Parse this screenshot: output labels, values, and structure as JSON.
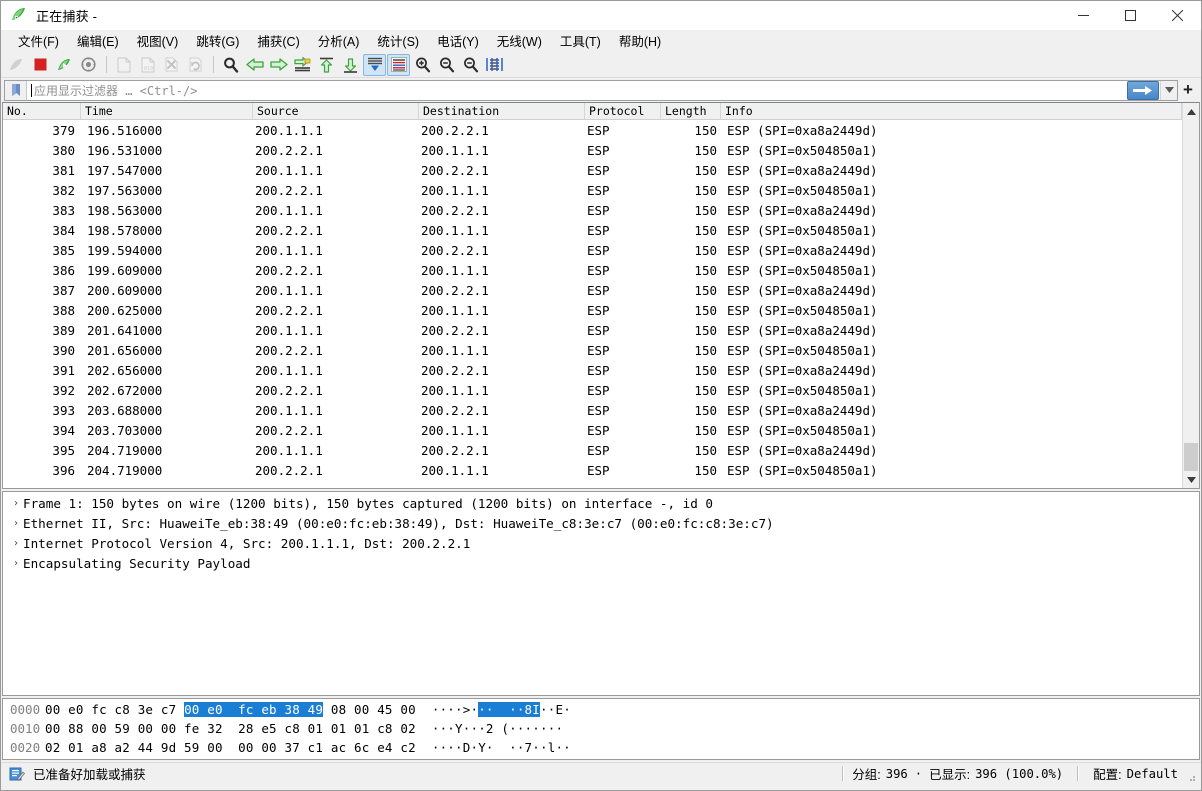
{
  "window": {
    "title": "正在捕获 -",
    "app_icon": "wireshark-shark-fin-icon",
    "minimize": "—",
    "maximize": "□",
    "close": "✕"
  },
  "menubar": [
    {
      "label": "文件(F)",
      "name": "menu-file"
    },
    {
      "label": "编辑(E)",
      "name": "menu-edit"
    },
    {
      "label": "视图(V)",
      "name": "menu-view"
    },
    {
      "label": "跳转(G)",
      "name": "menu-go"
    },
    {
      "label": "捕获(C)",
      "name": "menu-capture"
    },
    {
      "label": "分析(A)",
      "name": "menu-analyze"
    },
    {
      "label": "统计(S)",
      "name": "menu-statistics"
    },
    {
      "label": "电话(Y)",
      "name": "menu-telephony"
    },
    {
      "label": "无线(W)",
      "name": "menu-wireless"
    },
    {
      "label": "工具(T)",
      "name": "menu-tools"
    },
    {
      "label": "帮助(H)",
      "name": "menu-help"
    }
  ],
  "toolbar": {
    "items": [
      {
        "icon": "start-capture-icon",
        "state": "disabled"
      },
      {
        "icon": "stop-capture-icon",
        "state": "normal"
      },
      {
        "icon": "restart-capture-icon",
        "state": "normal"
      },
      {
        "icon": "capture-options-icon",
        "state": "normal"
      },
      {
        "icon": "separator",
        "state": "sep"
      },
      {
        "icon": "open-file-icon",
        "state": "disabled"
      },
      {
        "icon": "save-file-icon",
        "state": "disabled"
      },
      {
        "icon": "close-file-icon",
        "state": "disabled"
      },
      {
        "icon": "reload-file-icon",
        "state": "disabled"
      },
      {
        "icon": "separator",
        "state": "sep"
      },
      {
        "icon": "find-packet-icon",
        "state": "normal"
      },
      {
        "icon": "go-back-icon",
        "state": "normal"
      },
      {
        "icon": "go-forward-icon",
        "state": "normal"
      },
      {
        "icon": "go-to-packet-icon",
        "state": "normal"
      },
      {
        "icon": "go-first-packet-icon",
        "state": "normal"
      },
      {
        "icon": "go-last-packet-icon",
        "state": "normal"
      },
      {
        "icon": "auto-scroll-icon",
        "state": "checked"
      },
      {
        "icon": "colorize-icon",
        "state": "checked"
      },
      {
        "icon": "zoom-in-icon",
        "state": "normal"
      },
      {
        "icon": "zoom-out-icon",
        "state": "normal"
      },
      {
        "icon": "zoom-reset-icon",
        "state": "normal"
      },
      {
        "icon": "resize-columns-icon",
        "state": "normal"
      }
    ]
  },
  "filter": {
    "bookmark_icon": "bookmark-icon",
    "value": "",
    "placeholder": "应用显示过滤器 … <Ctrl-/>",
    "apply_icon": "apply-filter-arrow-icon",
    "dropdown_icon": "chevron-down-icon",
    "add_label": "+",
    "accent_color": "#4a86c8"
  },
  "packet_list": {
    "columns": [
      {
        "key": "no",
        "label": "No."
      },
      {
        "key": "time",
        "label": "Time"
      },
      {
        "key": "src",
        "label": "Source"
      },
      {
        "key": "dst",
        "label": "Destination"
      },
      {
        "key": "proto",
        "label": "Protocol"
      },
      {
        "key": "len",
        "label": "Length"
      },
      {
        "key": "info",
        "label": "Info"
      }
    ],
    "rows": [
      {
        "no": "379",
        "time": "196.516000",
        "src": "200.1.1.1",
        "dst": "200.2.2.1",
        "proto": "ESP",
        "len": "150",
        "info": "ESP (SPI=0xa8a2449d)"
      },
      {
        "no": "380",
        "time": "196.531000",
        "src": "200.2.2.1",
        "dst": "200.1.1.1",
        "proto": "ESP",
        "len": "150",
        "info": "ESP (SPI=0x504850a1)"
      },
      {
        "no": "381",
        "time": "197.547000",
        "src": "200.1.1.1",
        "dst": "200.2.2.1",
        "proto": "ESP",
        "len": "150",
        "info": "ESP (SPI=0xa8a2449d)"
      },
      {
        "no": "382",
        "time": "197.563000",
        "src": "200.2.2.1",
        "dst": "200.1.1.1",
        "proto": "ESP",
        "len": "150",
        "info": "ESP (SPI=0x504850a1)"
      },
      {
        "no": "383",
        "time": "198.563000",
        "src": "200.1.1.1",
        "dst": "200.2.2.1",
        "proto": "ESP",
        "len": "150",
        "info": "ESP (SPI=0xa8a2449d)"
      },
      {
        "no": "384",
        "time": "198.578000",
        "src": "200.2.2.1",
        "dst": "200.1.1.1",
        "proto": "ESP",
        "len": "150",
        "info": "ESP (SPI=0x504850a1)"
      },
      {
        "no": "385",
        "time": "199.594000",
        "src": "200.1.1.1",
        "dst": "200.2.2.1",
        "proto": "ESP",
        "len": "150",
        "info": "ESP (SPI=0xa8a2449d)"
      },
      {
        "no": "386",
        "time": "199.609000",
        "src": "200.2.2.1",
        "dst": "200.1.1.1",
        "proto": "ESP",
        "len": "150",
        "info": "ESP (SPI=0x504850a1)"
      },
      {
        "no": "387",
        "time": "200.609000",
        "src": "200.1.1.1",
        "dst": "200.2.2.1",
        "proto": "ESP",
        "len": "150",
        "info": "ESP (SPI=0xa8a2449d)"
      },
      {
        "no": "388",
        "time": "200.625000",
        "src": "200.2.2.1",
        "dst": "200.1.1.1",
        "proto": "ESP",
        "len": "150",
        "info": "ESP (SPI=0x504850a1)"
      },
      {
        "no": "389",
        "time": "201.641000",
        "src": "200.1.1.1",
        "dst": "200.2.2.1",
        "proto": "ESP",
        "len": "150",
        "info": "ESP (SPI=0xa8a2449d)"
      },
      {
        "no": "390",
        "time": "201.656000",
        "src": "200.2.2.1",
        "dst": "200.1.1.1",
        "proto": "ESP",
        "len": "150",
        "info": "ESP (SPI=0x504850a1)"
      },
      {
        "no": "391",
        "time": "202.656000",
        "src": "200.1.1.1",
        "dst": "200.2.2.1",
        "proto": "ESP",
        "len": "150",
        "info": "ESP (SPI=0xa8a2449d)"
      },
      {
        "no": "392",
        "time": "202.672000",
        "src": "200.2.2.1",
        "dst": "200.1.1.1",
        "proto": "ESP",
        "len": "150",
        "info": "ESP (SPI=0x504850a1)"
      },
      {
        "no": "393",
        "time": "203.688000",
        "src": "200.1.1.1",
        "dst": "200.2.2.1",
        "proto": "ESP",
        "len": "150",
        "info": "ESP (SPI=0xa8a2449d)"
      },
      {
        "no": "394",
        "time": "203.703000",
        "src": "200.2.2.1",
        "dst": "200.1.1.1",
        "proto": "ESP",
        "len": "150",
        "info": "ESP (SPI=0x504850a1)"
      },
      {
        "no": "395",
        "time": "204.719000",
        "src": "200.1.1.1",
        "dst": "200.2.2.1",
        "proto": "ESP",
        "len": "150",
        "info": "ESP (SPI=0xa8a2449d)"
      },
      {
        "no": "396",
        "time": "204.719000",
        "src": "200.2.2.1",
        "dst": "200.1.1.1",
        "proto": "ESP",
        "len": "150",
        "info": "ESP (SPI=0x504850a1)"
      }
    ]
  },
  "packet_detail": {
    "rows": [
      {
        "caret": "›",
        "text": "Frame 1: 150 bytes on wire (1200 bits), 150 bytes captured (1200 bits) on interface -, id 0"
      },
      {
        "caret": "›",
        "text": "Ethernet II, Src: HuaweiTe_eb:38:49 (00:e0:fc:eb:38:49), Dst: HuaweiTe_c8:3e:c7 (00:e0:fc:c8:3e:c7)"
      },
      {
        "caret": "›",
        "text": "Internet Protocol Version 4, Src: 200.1.1.1, Dst: 200.2.2.1"
      },
      {
        "caret": "›",
        "text": "Encapsulating Security Payload"
      }
    ]
  },
  "hex_dump": {
    "highlight_color": "#1a7fd4",
    "rows": [
      {
        "offset": "0000",
        "bytes_pre": "00 e0 fc c8 3e c7 ",
        "bytes_hl": "00 e0  fc eb 38 49",
        "bytes_post": " 08 00 45 00",
        "ascii_pre": "····>·",
        "ascii_hl": "··  ··8I",
        "ascii_post": "··E·"
      },
      {
        "offset": "0010",
        "bytes_pre": "00 88 00 59 00 00 fe 32  28 e5 c8 01 01 01 c8 02",
        "bytes_hl": "",
        "bytes_post": "",
        "ascii_pre": "···Y···2 (·······",
        "ascii_hl": "",
        "ascii_post": ""
      },
      {
        "offset": "0020",
        "bytes_pre": "02 01 a8 a2 44 9d 59 00  00 00 37 c1 ac 6c e4 c2",
        "bytes_hl": "",
        "bytes_post": "",
        "ascii_pre": "····D·Y·  ··7··l··",
        "ascii_hl": "",
        "ascii_post": ""
      }
    ]
  },
  "statusbar": {
    "icon": "capture-ready-icon",
    "message": "已准备好加载或捕获",
    "packets_label": "分组:",
    "packets_value": "396",
    "separator_dot": "·",
    "displayed_label": "已显示:",
    "displayed_value": "396 (100.0%)",
    "profile_label": "配置:",
    "profile_value": "Default"
  }
}
